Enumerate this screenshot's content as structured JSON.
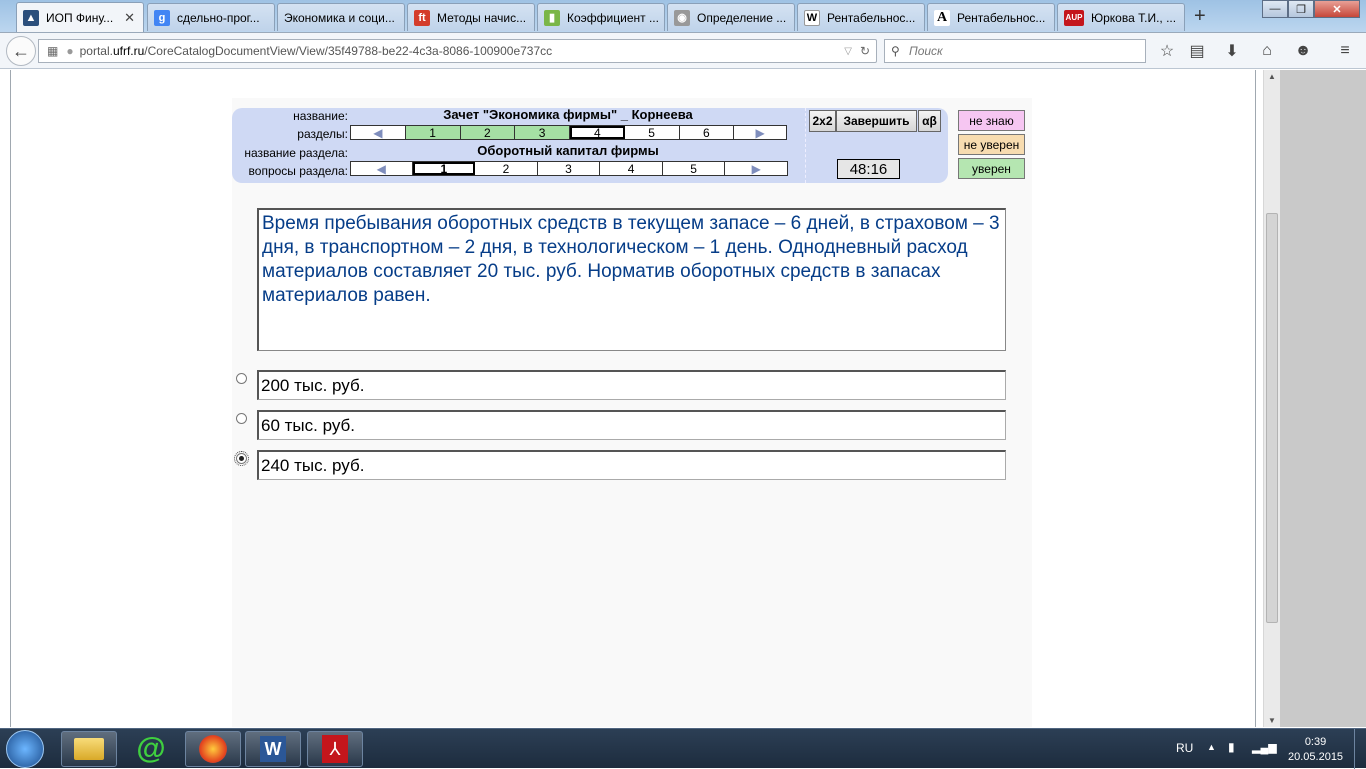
{
  "browser": {
    "tabs": [
      {
        "label": "ИОП Фину...",
        "icon": "hat-icon",
        "color": "#2b4f7c"
      },
      {
        "label": "сдельно-прог...",
        "icon": "google-icon",
        "color": "#4285f4"
      },
      {
        "label": "Экономика и соци...",
        "icon": "blank-page-icon",
        "color": "#ffffff"
      },
      {
        "label": "Методы начис...",
        "icon": "ft-icon",
        "color": "#d43c2a"
      },
      {
        "label": "Коэффициент ...",
        "icon": "bars-icon",
        "color": "#7ab648"
      },
      {
        "label": "Определение ...",
        "icon": "globe-icon",
        "color": "#999999"
      },
      {
        "label": "Рентабельнос...",
        "icon": "wikipedia-icon",
        "color": "#ffffff"
      },
      {
        "label": "Рентабельнос...",
        "icon": "a-letter-icon",
        "color": "#ffffff"
      },
      {
        "label": "Юркова Т.И., ...",
        "icon": "aup-icon",
        "color": "#c4161c"
      }
    ],
    "new_tab": "+",
    "url_scheme_host": "portal.",
    "url_host": "ufrf.ru",
    "url_path": "/CoreCatalogDocumentView/View/35f49788-be22-4c3a-8086-100900e737cc",
    "search_placeholder": "Поиск"
  },
  "quiz": {
    "labels": {
      "name": "название:",
      "sections": "разделы:",
      "section_name": "название раздела:",
      "section_questions": "вопросы раздела:"
    },
    "test_title": "Зачет \"Экономика фирмы\" _ Корнеева",
    "sections": [
      "1",
      "2",
      "3",
      "4",
      "5",
      "6"
    ],
    "section_title": "Оборотный капитал фирмы",
    "questions": [
      "1",
      "2",
      "3",
      "4",
      "5"
    ],
    "buttons": {
      "grid": "2x2",
      "finish": "Завершить",
      "alphabet": "αβ"
    },
    "timer": "48:16",
    "confidence": {
      "dont_know": "не знаю",
      "unsure": "не уверен",
      "sure": "уверен"
    },
    "question_text": "Время пребывания оборотных средств в текущем запасе – 6 дней, в страховом – 3 дня, в транспортном – 2 дня, в технологическом – 1 день. Однодневный расход материалов составляет 20 тыс. руб. Норматив оборотных средств в запасах материалов равен.",
    "answers": [
      {
        "text": "200 тыс. руб.",
        "selected": false
      },
      {
        "text": "60 тыс. руб.",
        "selected": false
      },
      {
        "text": "240 тыс. руб.",
        "selected": true
      }
    ]
  },
  "taskbar": {
    "lang": "RU",
    "time": "0:39",
    "date": "20.05.2015",
    "apps": [
      "explorer-icon",
      "mail-ru-agent-icon",
      "firefox-icon",
      "word-icon",
      "acrobat-icon"
    ]
  }
}
